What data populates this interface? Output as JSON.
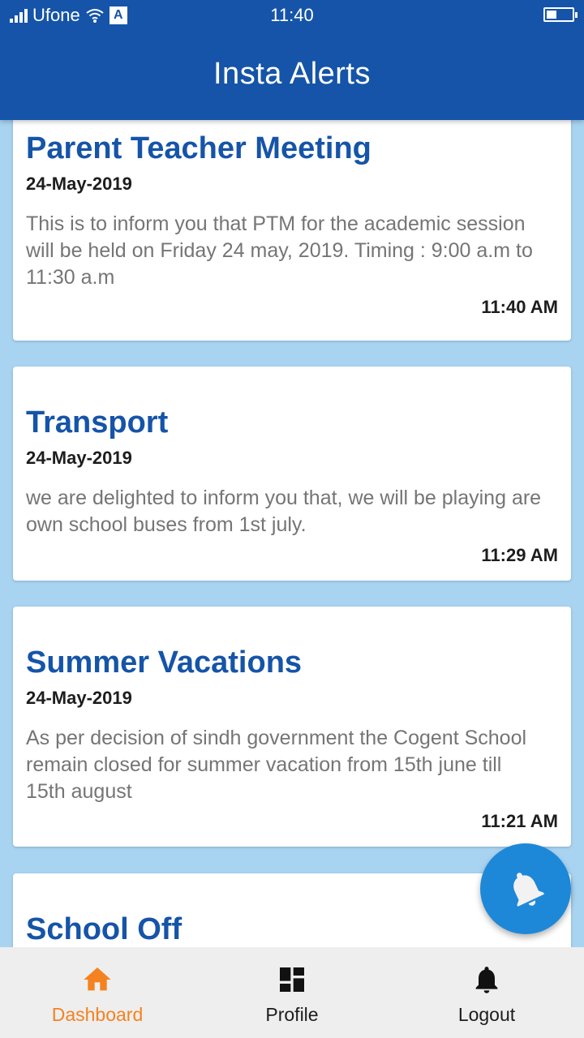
{
  "status_bar": {
    "carrier": "Ufone",
    "time": "11:40"
  },
  "app": {
    "title": "Insta Alerts"
  },
  "colors": {
    "primary": "#1554a8",
    "background": "#a8d4f2",
    "fab": "#1e88d8",
    "active_nav": "#f58220"
  },
  "alerts": [
    {
      "title": "Parent Teacher Meeting",
      "date": "24-May-2019",
      "body": "This is to inform you that PTM for the academic session will be held on Friday 24 may, 2019. Timing : 9:00 a.m to 11:30 a.m",
      "time": "11:40 AM"
    },
    {
      "title": "Transport",
      "date": "24-May-2019",
      "body": "we are delighted to inform you that, we will be playing are own school buses from 1st july.",
      "time": "11:29 AM"
    },
    {
      "title": "Summer Vacations",
      "date": "24-May-2019",
      "body": "As per decision of sindh government the Cogent School remain closed for summer vacation from 15th june till 15th august",
      "time": "11:21 AM"
    },
    {
      "title": "School Off"
    }
  ],
  "fab": {
    "icon": "bell-icon"
  },
  "bottom_nav": [
    {
      "label": "Dashboard",
      "icon": "home-icon",
      "active": true
    },
    {
      "label": "Profile",
      "icon": "dashboard-grid-icon",
      "active": false
    },
    {
      "label": "Logout",
      "icon": "bell-icon",
      "active": false
    }
  ]
}
